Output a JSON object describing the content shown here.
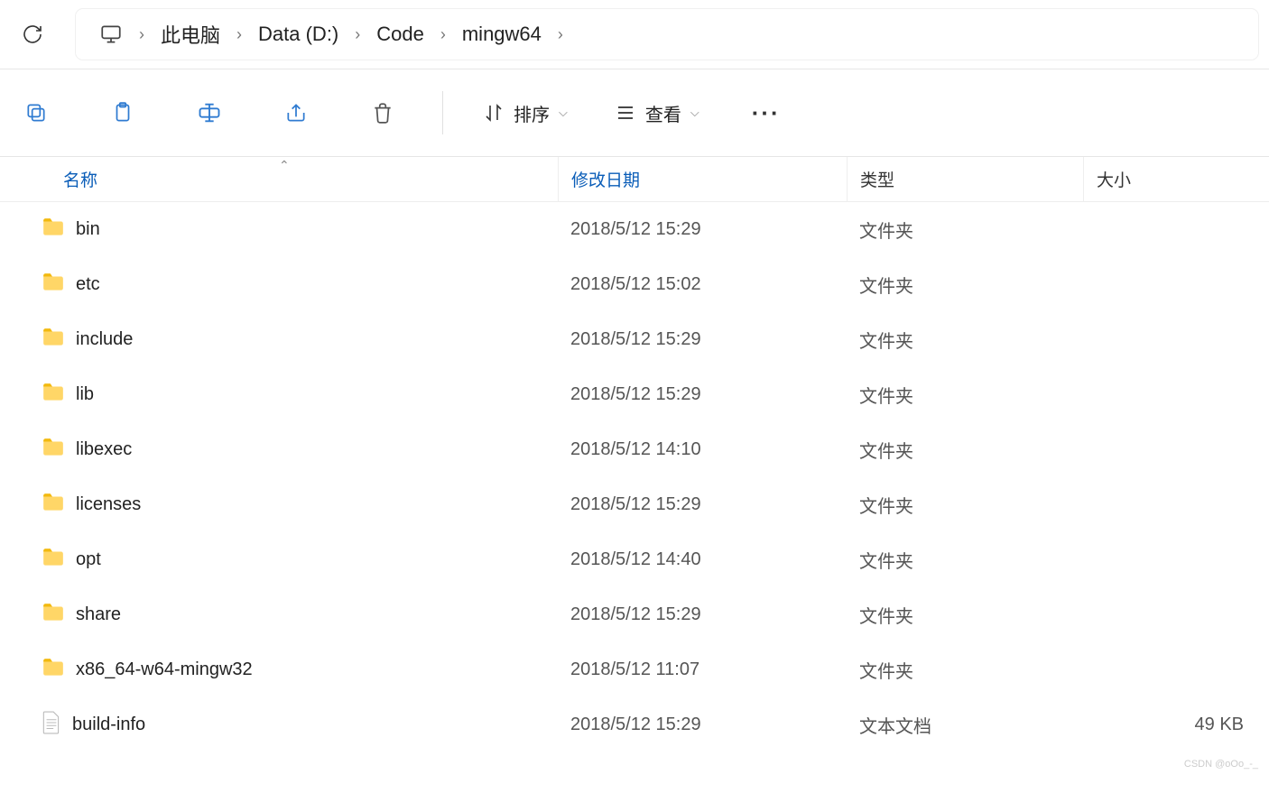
{
  "breadcrumb": {
    "items": [
      "此电脑",
      "Data (D:)",
      "Code",
      "mingw64"
    ]
  },
  "toolbar": {
    "sort_label": "排序",
    "view_label": "查看"
  },
  "columns": {
    "name": "名称",
    "date": "修改日期",
    "type": "类型",
    "size": "大小"
  },
  "rows": [
    {
      "icon": "folder",
      "name": "bin",
      "date": "2018/5/12 15:29",
      "type": "文件夹",
      "size": ""
    },
    {
      "icon": "folder",
      "name": "etc",
      "date": "2018/5/12 15:02",
      "type": "文件夹",
      "size": ""
    },
    {
      "icon": "folder",
      "name": "include",
      "date": "2018/5/12 15:29",
      "type": "文件夹",
      "size": ""
    },
    {
      "icon": "folder",
      "name": "lib",
      "date": "2018/5/12 15:29",
      "type": "文件夹",
      "size": ""
    },
    {
      "icon": "folder",
      "name": "libexec",
      "date": "2018/5/12 14:10",
      "type": "文件夹",
      "size": ""
    },
    {
      "icon": "folder",
      "name": "licenses",
      "date": "2018/5/12 15:29",
      "type": "文件夹",
      "size": ""
    },
    {
      "icon": "folder",
      "name": "opt",
      "date": "2018/5/12 14:40",
      "type": "文件夹",
      "size": ""
    },
    {
      "icon": "folder",
      "name": "share",
      "date": "2018/5/12 15:29",
      "type": "文件夹",
      "size": ""
    },
    {
      "icon": "folder",
      "name": "x86_64-w64-mingw32",
      "date": "2018/5/12 11:07",
      "type": "文件夹",
      "size": ""
    },
    {
      "icon": "file",
      "name": "build-info",
      "date": "2018/5/12 15:29",
      "type": "文本文档",
      "size": "49 KB"
    }
  ],
  "watermark": "CSDN @oOo_-_"
}
